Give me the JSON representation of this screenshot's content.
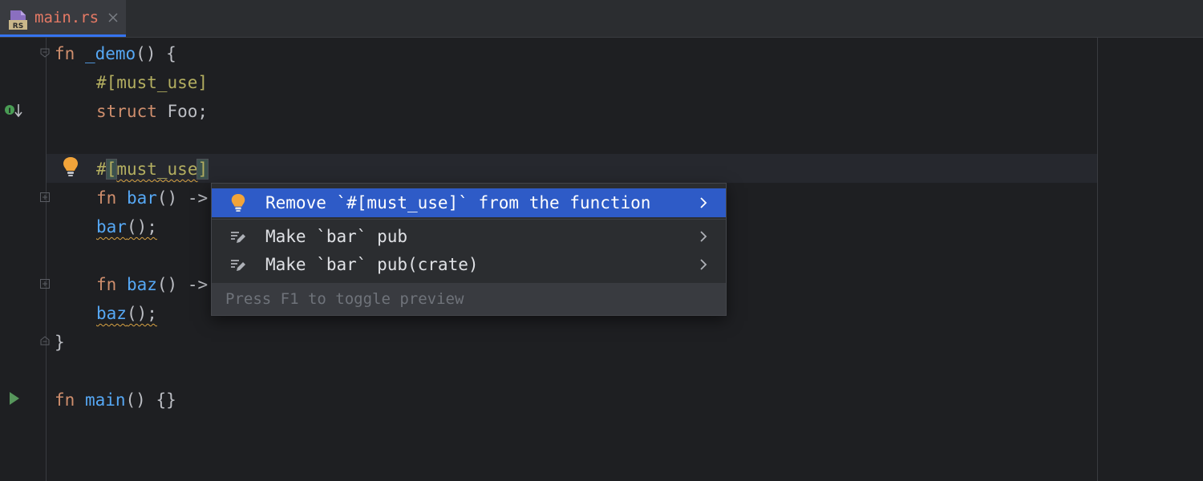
{
  "tab": {
    "title": "main.rs",
    "icon": "rust-file-icon",
    "icon_text": "RS"
  },
  "code": {
    "l1": {
      "kw": "fn",
      "name": "_demo",
      "rest": "() {"
    },
    "l2": {
      "attr": "#[must_use]"
    },
    "l3": {
      "kw": "struct",
      "rest": " Foo;"
    },
    "l5": {
      "hash": "#",
      "lb": "[",
      "attr": "must_use",
      "rb": "]"
    },
    "l6": {
      "kw": "fn",
      "name": "bar",
      "rest": "() ->"
    },
    "l7": {
      "call": "bar",
      "rest": "();"
    },
    "l9": {
      "kw": "fn",
      "name": "baz",
      "rest": "() ->"
    },
    "l10": {
      "call": "baz",
      "rest": "();"
    },
    "l11": {
      "rest": "}"
    },
    "l13": {
      "kw": "fn",
      "name": "main",
      "rest": "() {}"
    }
  },
  "intention_popup": {
    "items": [
      {
        "label": "Remove `#[must_use]` from the function",
        "icon": "lightbulb-icon",
        "selected": true
      },
      {
        "label": "Make `bar` pub",
        "icon": "quick-fix-pencil-icon",
        "selected": false
      },
      {
        "label": "Make `bar` pub(crate)",
        "icon": "quick-fix-pencil-icon",
        "selected": false
      }
    ],
    "footer": "Press F1 to toggle preview"
  },
  "colors": {
    "editor_bg": "#1e1f22",
    "keyword": "#cf8e6d",
    "function": "#56a8f5",
    "attribute": "#b3ae60",
    "selection": "#2e5bc7",
    "tab_title": "#e67a65",
    "warning": "#d9a343"
  }
}
